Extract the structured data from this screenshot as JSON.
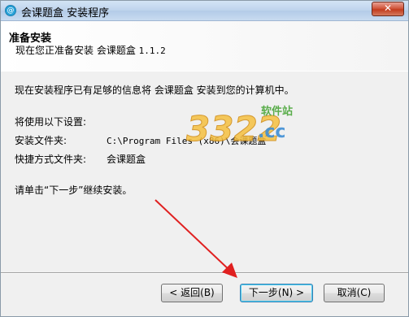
{
  "window": {
    "title": "会课题盒 安装程序",
    "app_icon_glyph": "@",
    "close_glyph": "✕"
  },
  "header": {
    "title": "准备安装",
    "subtitle_prefix": "现在您正准备安装 会课题盒 ",
    "subtitle_version": "1.1.2"
  },
  "body": {
    "ready_text": "现在安装程序已有足够的信息将 会课题盒 安装到您的计算机中。",
    "settings_heading": "将使用以下设置:",
    "install_folder_label": "安装文件夹:",
    "install_folder_value": "C:\\Program Files (x86)\\会课题盒",
    "shortcut_folder_label": "快捷方式文件夹:",
    "shortcut_folder_value": "会课题盒",
    "instruction": "请单击“下一步”继续安装。"
  },
  "watermark": {
    "number": "3322",
    "site_label": "软件站",
    "domain": ".cc"
  },
  "buttons": {
    "back": "< 返回(B)",
    "next": "下一步(N) >",
    "cancel": "取消(C)"
  },
  "colors": {
    "arrow": "#e02020",
    "title_gradient_top": "#d3e4f5",
    "close_red": "#c23c1e",
    "default_button_border": "#3c7fb1"
  }
}
